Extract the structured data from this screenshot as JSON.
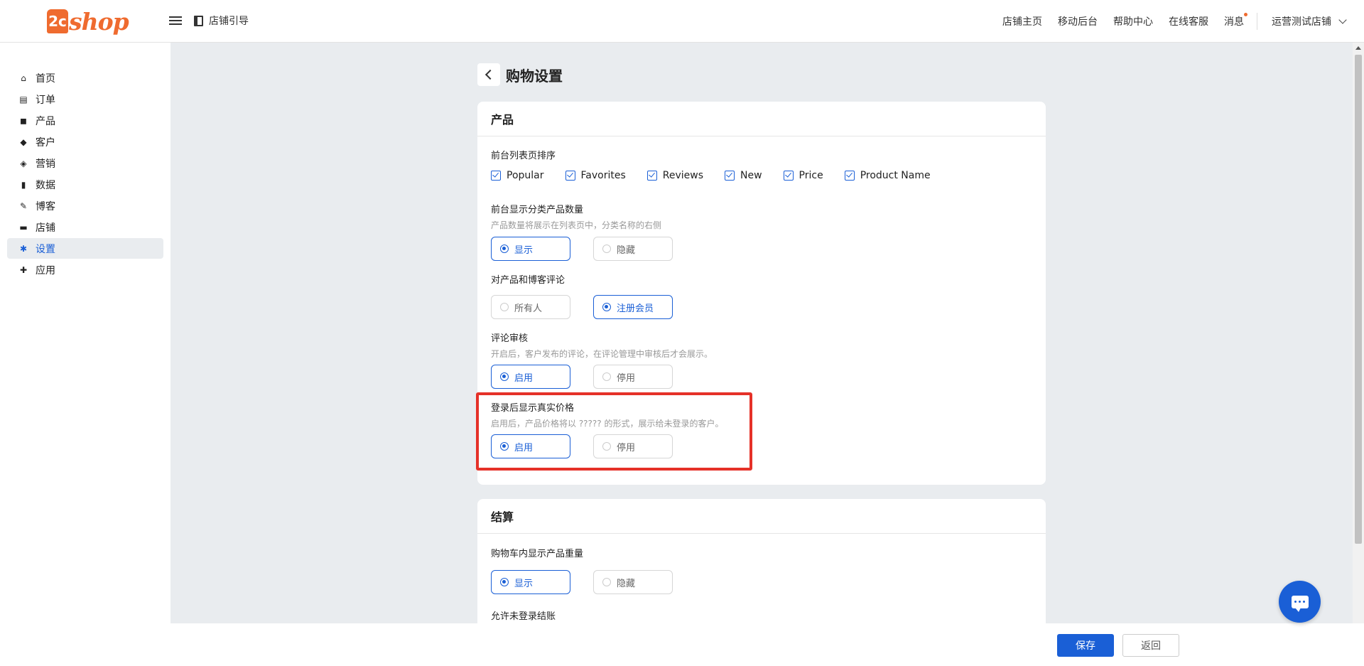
{
  "logo": {
    "mark": "2c",
    "text": "shop"
  },
  "header": {
    "guide_label": "店铺引导",
    "nav": [
      "店铺主页",
      "移动后台",
      "帮助中心",
      "在线客服",
      "消息"
    ],
    "store_name": "运营测试店铺"
  },
  "sidebar": {
    "items": [
      {
        "label": "首页",
        "icon": "home-icon",
        "glyph": "⌂"
      },
      {
        "label": "订单",
        "icon": "clipboard-icon",
        "glyph": "▤"
      },
      {
        "label": "产品",
        "icon": "bag-icon",
        "glyph": "◼"
      },
      {
        "label": "客户",
        "icon": "diamond-icon",
        "glyph": "◆"
      },
      {
        "label": "营销",
        "icon": "tag-icon",
        "glyph": "◈"
      },
      {
        "label": "数据",
        "icon": "bar-chart-icon",
        "glyph": "▮"
      },
      {
        "label": "博客",
        "icon": "edit-icon",
        "glyph": "✎"
      },
      {
        "label": "店铺",
        "icon": "store-icon",
        "glyph": "▬"
      },
      {
        "label": "设置",
        "icon": "gear-icon",
        "glyph": "✱"
      },
      {
        "label": "应用",
        "icon": "puzzle-icon",
        "glyph": "✚"
      }
    ],
    "active_index": 8
  },
  "page": {
    "title": "购物设置"
  },
  "product_card": {
    "title": "产品",
    "sort": {
      "label": "前台列表页排序",
      "options": [
        "Popular",
        "Favorites",
        "Reviews",
        "New",
        "Price",
        "Product Name"
      ]
    },
    "category_count": {
      "label": "前台显示分类产品数量",
      "hint": "产品数量将展示在列表页中，分类名称的右侧",
      "options": [
        "显示",
        "隐藏"
      ],
      "selected": "显示"
    },
    "review_permission": {
      "label": "对产品和博客评论",
      "options": [
        "所有人",
        "注册会员"
      ],
      "selected": "注册会员"
    },
    "review_audit": {
      "label": "评论审核",
      "hint": "开启后，客户发布的评论，在评论管理中审核后才会展示。",
      "options": [
        "启用",
        "停用"
      ],
      "selected": "启用"
    },
    "real_price_login": {
      "label": "登录后显示真实价格",
      "hint": "启用后，产品价格将以 ????? 的形式，展示给未登录的客户。",
      "options": [
        "启用",
        "停用"
      ],
      "selected": "启用"
    }
  },
  "checkout_card": {
    "title": "结算",
    "weight_in_cart": {
      "label": "购物车内显示产品重量",
      "options": [
        "显示",
        "隐藏"
      ],
      "selected": "显示"
    },
    "guest_checkout": {
      "label": "允许未登录结账"
    }
  },
  "footer": {
    "save_label": "保存",
    "back_label": "返回"
  },
  "colors": {
    "brand": "#ef6b2f",
    "accent": "#1a5fd6",
    "highlight": "#e53128"
  }
}
